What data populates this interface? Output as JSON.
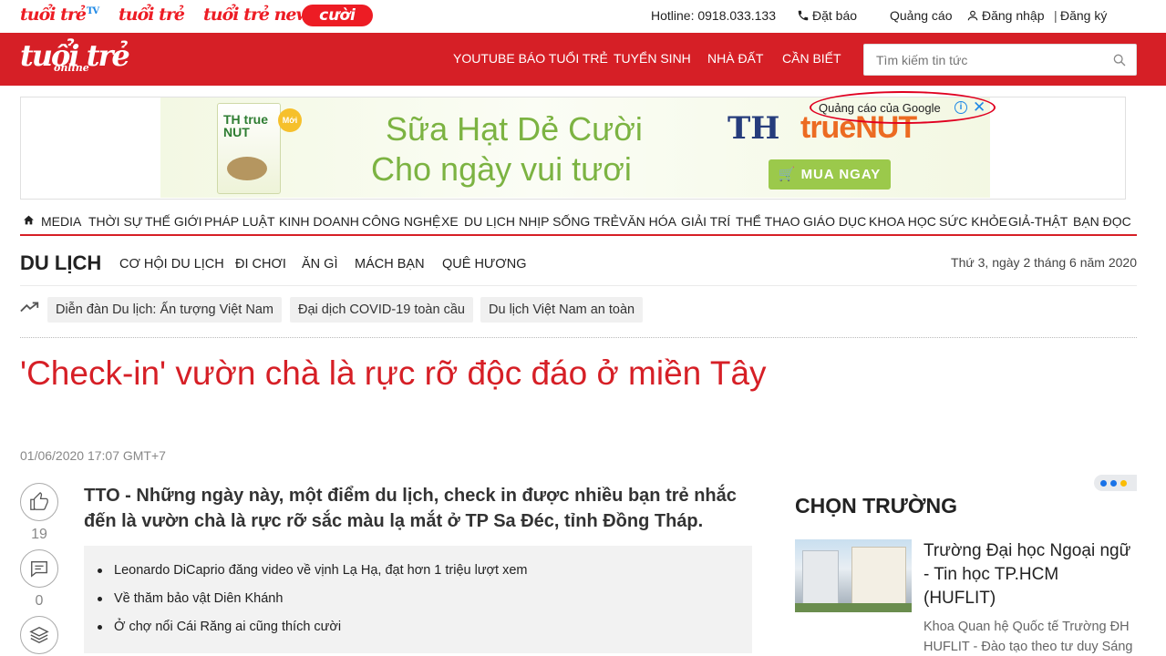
{
  "top_brands": [
    "tuổi trẻ",
    "tuổi trẻ",
    "tuổi trẻ news",
    "cười"
  ],
  "top_brand_tv": "TV",
  "top_links": {
    "hotline": "Hotline: 0918.033.133",
    "subscribe": "Đặt báo",
    "ads": "Quảng cáo",
    "login": "Đăng nhập",
    "sep": "|",
    "register": "Đăng ký"
  },
  "header": {
    "logo": "tuổi trẻ",
    "logo_sub": "online",
    "nav": [
      "YOUTUBE BÁO TUỔI TRẺ",
      "TUYỂN SINH",
      "NHÀ ĐẤT",
      "CẦN BIẾT"
    ],
    "search_placeholder": "Tìm kiếm tin tức"
  },
  "ad": {
    "carton_brand": "TH true NUT",
    "badge": "Mới",
    "line1": "Sữa Hạt Dẻ Cười",
    "line2": "Cho ngày vui tươi",
    "brand_th": "TH",
    "brand_truenut": "trueNUT",
    "cta": "MUA NGAY",
    "google_label": "Quảng cáo của Google"
  },
  "categories": [
    "MEDIA",
    "THỜI SỰ",
    "THẾ GIỚI",
    "PHÁP LUẬT",
    "KINH DOANH",
    "CÔNG NGHỆ",
    "XE",
    "DU LỊCH",
    "NHỊP SỐNG TRẺ",
    "VĂN HÓA",
    "GIẢI TRÍ",
    "THỂ THAO",
    "GIÁO DỤC",
    "KHOA HỌC",
    "SỨC KHỎE",
    "GIẢ-THẬT",
    "BẠN ĐỌC"
  ],
  "section": {
    "title": "DU LỊCH",
    "subs": [
      "CƠ HỘI DU LỊCH",
      "ĐI CHƠI",
      "ĂN GÌ",
      "MÁCH BẠN",
      "QUÊ HƯƠNG"
    ],
    "date": "Thứ 3, ngày 2 tháng 6 năm 2020"
  },
  "trending_tags": [
    "Diễn đàn Du lịch: Ấn tượng Việt Nam",
    "Đại dịch COVID-19 toàn cầu",
    "Du lịch Việt Nam an toàn"
  ],
  "article": {
    "title": "'Check-in' vườn chà là rực rỡ độc đáo ở miền Tây",
    "published": "01/06/2020 17:07 GMT+7",
    "sapo": "TTO - Những ngày này, một điểm du lịch, check in được nhiều bạn trẻ nhắc đến là vườn chà là rực rỡ sắc màu lạ mắt ở TP Sa Đéc, tỉnh Đồng Tháp.",
    "like_count": "19",
    "comment_count": "0",
    "related": [
      "Leonardo DiCaprio đăng video về vịnh Lạ Hạ, đạt hơn 1 triệu lượt xem",
      "Về thăm bảo vật Diên Khánh",
      "Ở chợ nổi Cái Răng ai cũng thích cười"
    ]
  },
  "sidebar": {
    "title": "CHỌN TRƯỜNG",
    "headline": "Trường Đại học Ngoại ngữ - Tin học TP.HCM (HUFLIT)",
    "desc": "Khoa Quan hệ Quốc tế Trường ĐH HUFLIT - Đào tạo theo tư duy Sáng"
  },
  "colors": {
    "brand_red": "#d61f26",
    "google_blue": "#1e88e5"
  }
}
